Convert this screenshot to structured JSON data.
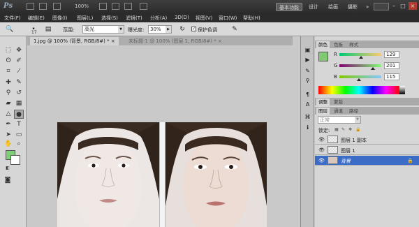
{
  "titlebar": {
    "app_logo": "Ps",
    "zoom_value": "100%",
    "workspaces": [
      "基本功能",
      "设计",
      "绘画",
      "摄影"
    ],
    "more": "»"
  },
  "menu": [
    "文件(F)",
    "编辑(E)",
    "图像(I)",
    "图层(L)",
    "选择(S)",
    "滤镜(T)",
    "分析(A)",
    "3D(D)",
    "视图(V)",
    "窗口(W)",
    "帮助(H)"
  ],
  "options": {
    "brush_size": "17",
    "range_label": "范围:",
    "range_value": "高光",
    "exposure_label": "曝光度:",
    "exposure_value": "30%",
    "protect_tones_label": "保护色调"
  },
  "tabs": [
    {
      "label": "1.jpg @ 100% (背景, RGB/8#) *",
      "active": true
    },
    {
      "label": "未标题-1 @ 100% (图层 1, RGB/8#) *",
      "active": false
    }
  ],
  "color_panel": {
    "tabs": [
      "颜色",
      "色板",
      "样式"
    ],
    "r_label": "R",
    "g_label": "G",
    "b_label": "B",
    "r": "129",
    "g": "201",
    "b": "115",
    "swatch": "#81c973"
  },
  "adjust_panel": {
    "tabs": [
      "调整",
      "蒙版"
    ]
  },
  "layers_panel": {
    "tabs": [
      "图层",
      "通道",
      "路径"
    ],
    "blend_mode": "正常",
    "lock_label": "锁定:",
    "layers": [
      {
        "name": "图层 1 副本",
        "selected": false
      },
      {
        "name": "图层 1",
        "selected": false
      },
      {
        "name": "背景",
        "selected": true
      }
    ]
  }
}
